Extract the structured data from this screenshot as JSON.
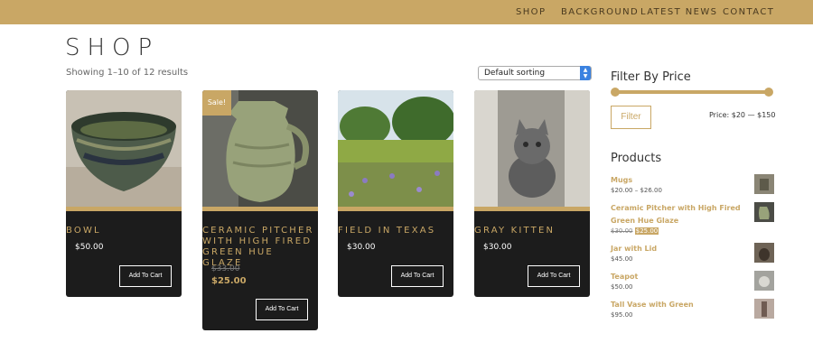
{
  "nav": {
    "items": [
      "SHOP",
      "BACKGROUND",
      "LATEST NEWS",
      "CONTACT"
    ]
  },
  "page": {
    "title": "SHOP",
    "results": "Showing 1–10 of 12 results",
    "sorting": "Default sorting"
  },
  "products": [
    {
      "title": "BOWL",
      "price": "$50.00",
      "button": "Add To Cart"
    },
    {
      "title": "CERAMIC PITCHER WITH HIGH FIRED GREEN HUE GLAZE",
      "old_price": "$33.00",
      "sale_price": "$25.00",
      "badge": "Sale!",
      "button": "Add To Cart"
    },
    {
      "title": "FIELD IN TEXAS",
      "price": "$30.00",
      "button": "Add To Cart"
    },
    {
      "title": "GRAY KITTEN",
      "price": "$30.00",
      "button": "Add To Cart"
    }
  ],
  "sidebar": {
    "filter_title": "Filter By Price",
    "filter_button": "Filter",
    "price_range": "Price: $20 — $150",
    "products_title": "Products",
    "products": [
      {
        "name": "Mugs",
        "price": "$20.00 – $26.00"
      },
      {
        "name": "Ceramic Pitcher with High Fired Green Hue Glaze",
        "old_price": "$30.00",
        "sale_price": "$25.00"
      },
      {
        "name": "Jar with Lid",
        "price": "$45.00"
      },
      {
        "name": "Teapot",
        "price": "$50.00"
      },
      {
        "name": "Tall Vase with Green",
        "price": "$95.00"
      }
    ]
  },
  "colors": {
    "accent": "#c9a765",
    "card_bg": "#1c1c1c"
  }
}
